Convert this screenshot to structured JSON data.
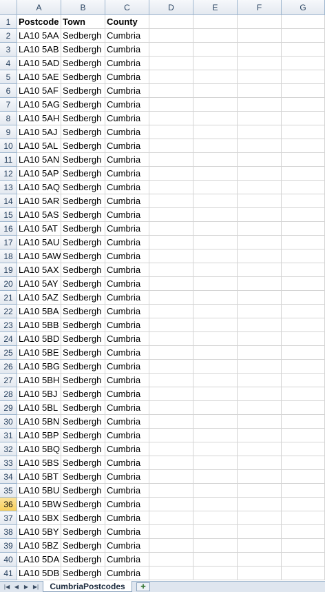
{
  "columns": [
    "A",
    "B",
    "C",
    "D",
    "E",
    "F",
    "G"
  ],
  "active_row": 36,
  "header_row": {
    "number": "1",
    "cells": [
      "Postcode",
      "Town",
      "County"
    ]
  },
  "rows": [
    {
      "n": "2",
      "c": [
        "LA10 5AA",
        "Sedbergh",
        "Cumbria"
      ]
    },
    {
      "n": "3",
      "c": [
        "LA10 5AB",
        "Sedbergh",
        "Cumbria"
      ]
    },
    {
      "n": "4",
      "c": [
        "LA10 5AD",
        "Sedbergh",
        "Cumbria"
      ]
    },
    {
      "n": "5",
      "c": [
        "LA10 5AE",
        "Sedbergh",
        "Cumbria"
      ]
    },
    {
      "n": "6",
      "c": [
        "LA10 5AF",
        "Sedbergh",
        "Cumbria"
      ]
    },
    {
      "n": "7",
      "c": [
        "LA10 5AG",
        "Sedbergh",
        "Cumbria"
      ]
    },
    {
      "n": "8",
      "c": [
        "LA10 5AH",
        "Sedbergh",
        "Cumbria"
      ]
    },
    {
      "n": "9",
      "c": [
        "LA10 5AJ",
        "Sedbergh",
        "Cumbria"
      ]
    },
    {
      "n": "10",
      "c": [
        "LA10 5AL",
        "Sedbergh",
        "Cumbria"
      ]
    },
    {
      "n": "11",
      "c": [
        "LA10 5AN",
        "Sedbergh",
        "Cumbria"
      ]
    },
    {
      "n": "12",
      "c": [
        "LA10 5AP",
        "Sedbergh",
        "Cumbria"
      ]
    },
    {
      "n": "13",
      "c": [
        "LA10 5AQ",
        "Sedbergh",
        "Cumbria"
      ]
    },
    {
      "n": "14",
      "c": [
        "LA10 5AR",
        "Sedbergh",
        "Cumbria"
      ]
    },
    {
      "n": "15",
      "c": [
        "LA10 5AS",
        "Sedbergh",
        "Cumbria"
      ]
    },
    {
      "n": "16",
      "c": [
        "LA10 5AT",
        "Sedbergh",
        "Cumbria"
      ]
    },
    {
      "n": "17",
      "c": [
        "LA10 5AU",
        "Sedbergh",
        "Cumbria"
      ]
    },
    {
      "n": "18",
      "c": [
        "LA10 5AW",
        "Sedbergh",
        "Cumbria"
      ]
    },
    {
      "n": "19",
      "c": [
        "LA10 5AX",
        "Sedbergh",
        "Cumbria"
      ]
    },
    {
      "n": "20",
      "c": [
        "LA10 5AY",
        "Sedbergh",
        "Cumbria"
      ]
    },
    {
      "n": "21",
      "c": [
        "LA10 5AZ",
        "Sedbergh",
        "Cumbria"
      ]
    },
    {
      "n": "22",
      "c": [
        "LA10 5BA",
        "Sedbergh",
        "Cumbria"
      ]
    },
    {
      "n": "23",
      "c": [
        "LA10 5BB",
        "Sedbergh",
        "Cumbria"
      ]
    },
    {
      "n": "24",
      "c": [
        "LA10 5BD",
        "Sedbergh",
        "Cumbria"
      ]
    },
    {
      "n": "25",
      "c": [
        "LA10 5BE",
        "Sedbergh",
        "Cumbria"
      ]
    },
    {
      "n": "26",
      "c": [
        "LA10 5BG",
        "Sedbergh",
        "Cumbria"
      ]
    },
    {
      "n": "27",
      "c": [
        "LA10 5BH",
        "Sedbergh",
        "Cumbria"
      ]
    },
    {
      "n": "28",
      "c": [
        "LA10 5BJ",
        "Sedbergh",
        "Cumbria"
      ]
    },
    {
      "n": "29",
      "c": [
        "LA10 5BL",
        "Sedbergh",
        "Cumbria"
      ]
    },
    {
      "n": "30",
      "c": [
        "LA10 5BN",
        "Sedbergh",
        "Cumbria"
      ]
    },
    {
      "n": "31",
      "c": [
        "LA10 5BP",
        "Sedbergh",
        "Cumbria"
      ]
    },
    {
      "n": "32",
      "c": [
        "LA10 5BQ",
        "Sedbergh",
        "Cumbria"
      ]
    },
    {
      "n": "33",
      "c": [
        "LA10 5BS",
        "Sedbergh",
        "Cumbria"
      ]
    },
    {
      "n": "34",
      "c": [
        "LA10 5BT",
        "Sedbergh",
        "Cumbria"
      ]
    },
    {
      "n": "35",
      "c": [
        "LA10 5BU",
        "Sedbergh",
        "Cumbria"
      ]
    },
    {
      "n": "36",
      "c": [
        "LA10 5BW",
        "Sedbergh",
        "Cumbria"
      ]
    },
    {
      "n": "37",
      "c": [
        "LA10 5BX",
        "Sedbergh",
        "Cumbria"
      ]
    },
    {
      "n": "38",
      "c": [
        "LA10 5BY",
        "Sedbergh",
        "Cumbria"
      ]
    },
    {
      "n": "39",
      "c": [
        "LA10 5BZ",
        "Sedbergh",
        "Cumbria"
      ]
    },
    {
      "n": "40",
      "c": [
        "LA10 5DA",
        "Sedbergh",
        "Cumbria"
      ]
    },
    {
      "n": "41",
      "c": [
        "LA10 5DB",
        "Sedbergh",
        "Cumbria"
      ]
    }
  ],
  "tabbar": {
    "sheet_tab": "CumbriaPostcodes",
    "nav_icons": [
      "first-sheet-icon",
      "prev-sheet-icon",
      "next-sheet-icon",
      "last-sheet-icon"
    ],
    "new_sheet_icon": "insert-sheet-icon"
  },
  "colors": {
    "header_border": "#9eb6ce",
    "gridline": "#d4d4d4",
    "active_row_header": "#f8cf5a"
  }
}
